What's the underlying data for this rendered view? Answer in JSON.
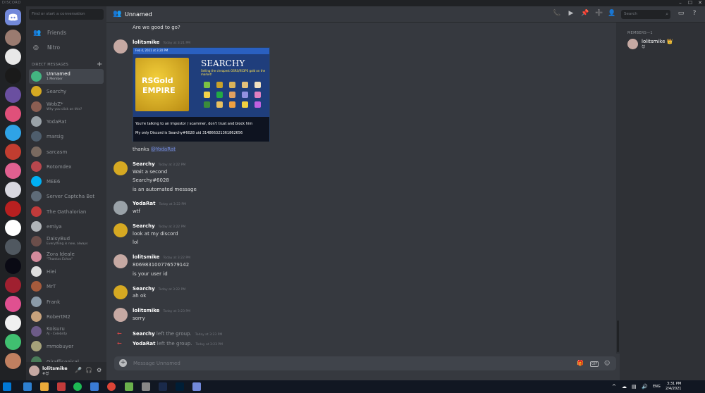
{
  "window": {
    "brand": "DISCORD",
    "min": "–",
    "max": "☐",
    "close": "✕"
  },
  "dm_sidebar": {
    "search_placeholder": "Find or start a conversation",
    "nav": [
      {
        "label": "Friends"
      },
      {
        "label": "Nitro"
      }
    ],
    "section_label": "DIRECT MESSAGES",
    "add_symbol": "+",
    "dms": [
      {
        "name": "Unnamed",
        "status": "1 Member",
        "selected": true,
        "color": "#43b581"
      },
      {
        "name": "Searchy",
        "status": "",
        "color": "#d6a922"
      },
      {
        "name": "WobZ*",
        "status": "Why you click on this?",
        "color": "#8b5e52"
      },
      {
        "name": "YodaRat",
        "status": "",
        "color": "#9aa2a8"
      },
      {
        "name": "marsig",
        "status": "",
        "color": "#4e5d6c"
      },
      {
        "name": "sarcasm",
        "status": "",
        "color": "#7a6a60"
      },
      {
        "name": "Rotomdex",
        "status": "",
        "color": "#b8474d"
      },
      {
        "name": "MEE6",
        "status": "",
        "color": "#00b0f4"
      },
      {
        "name": "Server Captcha Bot",
        "status": "",
        "color": "#5e6b78"
      },
      {
        "name": "The Oathalorian",
        "status": "",
        "color": "#c23b3b"
      },
      {
        "name": "emiya",
        "status": "",
        "color": "#b0b4b8"
      },
      {
        "name": "DaisyBud",
        "status": "Everything is now, always",
        "color": "#6b4e4a"
      },
      {
        "name": "Zora Ideale",
        "status": "\"Thankss Echos\"",
        "color": "#d48a9c"
      },
      {
        "name": "Hiei",
        "status": "",
        "color": "#dedede"
      },
      {
        "name": "MrT",
        "status": "",
        "color": "#a55b3c"
      },
      {
        "name": "Frank",
        "status": "",
        "color": "#8b9aa8"
      },
      {
        "name": "RobertM2",
        "status": "",
        "color": "#c7a27c"
      },
      {
        "name": "Koisuru",
        "status": "AJ - Celebrity",
        "color": "#6d5b88"
      },
      {
        "name": "mmobuyer",
        "status": "",
        "color": "#a6a27a"
      },
      {
        "name": "Girafficonical",
        "status": "",
        "color": "#4a7c59"
      }
    ]
  },
  "user_panel": {
    "name": "lolitsmike",
    "tag": "#😈",
    "mic": "🎤",
    "headset": "🎧",
    "settings": "⚙"
  },
  "header": {
    "title": "Unnamed",
    "search_placeholder": "Search",
    "icons": [
      "call-icon",
      "video-icon",
      "pin-icon",
      "add-member-icon",
      "members-icon",
      "inbox-icon",
      "help-icon"
    ]
  },
  "messages": {
    "top_line": "Are we good to go?",
    "m1": {
      "author": "lolitsmike",
      "time": "Today at 3:21 PM"
    },
    "embed": {
      "timestamp": "Feb 4, 2021 at 3:20 PM",
      "logo_line1": "RSGold",
      "logo_line2": "EMPIRE",
      "title": "SEARCHY",
      "subtitle": "Selling the cheapest OSRS/RS3PS gold on the market!",
      "warn1": "You're talking to an Impostor / scammer, don't trust and block him",
      "warn2": "My only Discord is Searchy#6028 uid 314866321361862656"
    },
    "m1_after": "thanks ",
    "m1_mention": "@YodaRat",
    "m2": {
      "author": "Searchy",
      "time": "Today at 3:22 PM",
      "lines": [
        "Wait a second",
        "Searchy#6028",
        "is an automated message"
      ]
    },
    "m3": {
      "author": "YodaRat",
      "time": "Today at 3:22 PM",
      "lines": [
        "wtf"
      ]
    },
    "m4": {
      "author": "Searchy",
      "time": "Today at 3:22 PM",
      "lines": [
        "look at my discord",
        "lol"
      ]
    },
    "m5": {
      "author": "lolitsmike",
      "time": "Today at 3:22 PM",
      "lines": [
        "806983100776579142",
        "is your user id"
      ]
    },
    "m6": {
      "author": "Searchy",
      "time": "Today at 3:22 PM",
      "lines": [
        "ah ok"
      ]
    },
    "m7": {
      "author": "lolitsmike",
      "time": "Today at 3:23 PM",
      "lines": [
        "sorry"
      ]
    },
    "sys1": {
      "name": "Searchy",
      "text": " left the group.",
      "time": "Today at 3:23 PM"
    },
    "sys2": {
      "name": "YodaRat",
      "text": " left the group.",
      "time": "Today at 3:23 PM"
    }
  },
  "composer": {
    "placeholder": "Message Unnamed",
    "plus": "+"
  },
  "members_panel": {
    "heading": "MEMBERS—1",
    "name": "lolitsmike 👑",
    "status": "😈"
  },
  "taskbar": {
    "time": "3:31 PM",
    "date": "2/4/2021",
    "lang": "ENG"
  },
  "colors": {
    "accent": "#7289da",
    "online": "#43b581",
    "red": "#f04747",
    "bg": "#36393f"
  }
}
